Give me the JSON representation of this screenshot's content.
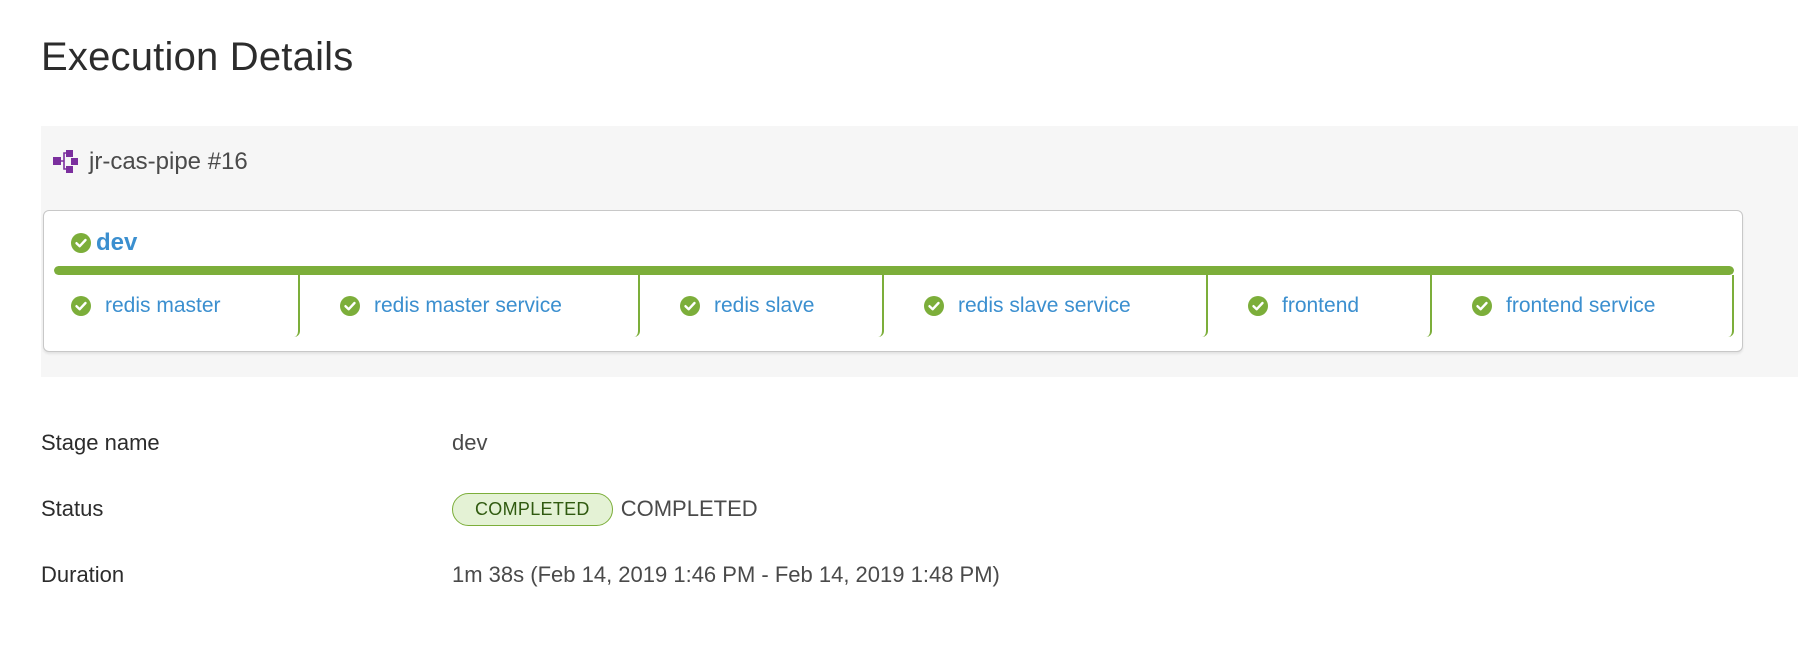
{
  "page": {
    "title": "Execution Details"
  },
  "pipeline": {
    "name": "jr-cas-pipe #16",
    "icon": "pipeline-icon",
    "stage": {
      "name": "dev",
      "status_icon": "check-circle-icon",
      "progress": 1.0,
      "tasks": [
        {
          "label": "redis master",
          "status_icon": "check-circle-icon"
        },
        {
          "label": "redis master service",
          "status_icon": "check-circle-icon"
        },
        {
          "label": "redis slave",
          "status_icon": "check-circle-icon"
        },
        {
          "label": "redis slave service",
          "status_icon": "check-circle-icon"
        },
        {
          "label": "frontend",
          "status_icon": "check-circle-icon"
        },
        {
          "label": "frontend service",
          "status_icon": "check-circle-icon"
        }
      ]
    }
  },
  "details": {
    "stage_name": {
      "label": "Stage name",
      "value": "dev"
    },
    "status": {
      "label": "Status",
      "badge": "COMPLETED",
      "value": "COMPLETED"
    },
    "duration": {
      "label": "Duration",
      "value": "1m 38s (Feb 14, 2019 1:46 PM - Feb 14, 2019 1:48 PM)"
    }
  },
  "colors": {
    "success": "#7cae3a",
    "link": "#3b8fcf",
    "pipeline_icon": "#7b2f9e",
    "badge_bg": "#e4f2d5"
  }
}
